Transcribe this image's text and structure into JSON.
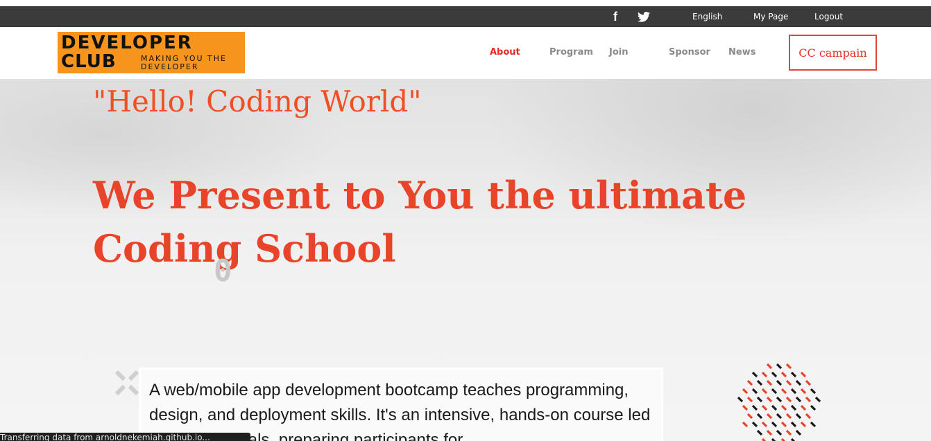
{
  "topbar": {
    "social_icons": [
      "facebook-icon",
      "twitter-icon"
    ],
    "facebook_glyph": "f",
    "language": "English",
    "my_page": "My Page",
    "logout": "Logout"
  },
  "logo": {
    "line1": "DEVELOPER",
    "line2": "CLUB",
    "tagline": "MAKING YOU THE DEVELOPER"
  },
  "nav": {
    "items": [
      {
        "label": "About",
        "active": true
      },
      {
        "label": "Program",
        "active": false
      },
      {
        "label": "Join",
        "active": false
      },
      {
        "label": "Sponsor",
        "active": false
      },
      {
        "label": "News",
        "active": false
      }
    ],
    "cta_label": "CC campain"
  },
  "hero": {
    "hello": "\"Hello! Coding World\"",
    "headline": "We Present to You the ultimate Coding School",
    "decor_digit": "0",
    "description": "A web/mobile app development bootcamp teaches programming, design, and deployment skills. It's an intensive, hands-on course led by professionals, preparing participants for"
  },
  "status_bar": {
    "text": "Transferring data from arnoldnekemiah.github.io..."
  },
  "colors": {
    "accent": "#e52d27",
    "headline": "#e8442a",
    "logo_bg": "#f7941d",
    "topbar_bg": "#3b3b3b"
  }
}
